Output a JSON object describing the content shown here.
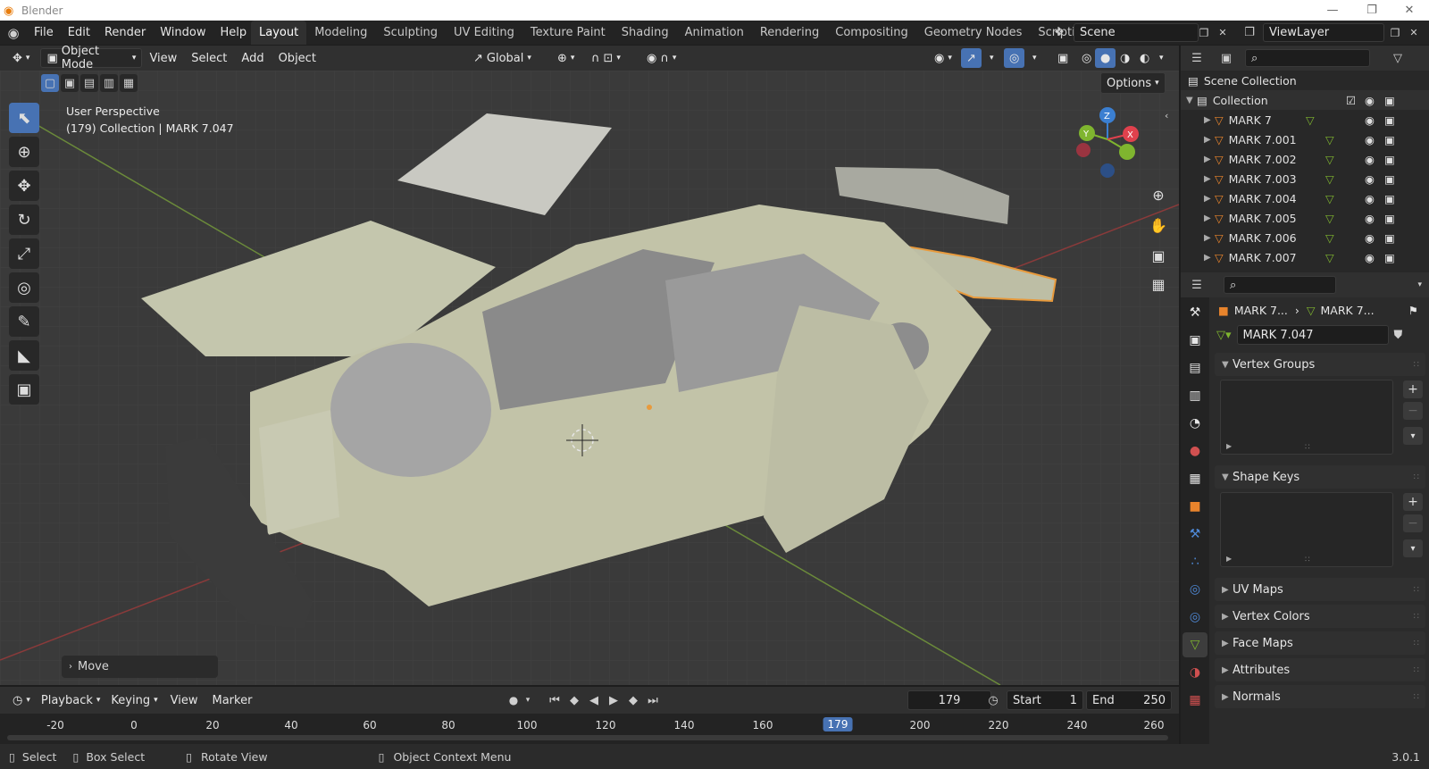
{
  "window": {
    "title": "Blender"
  },
  "menu": {
    "file": "File",
    "edit": "Edit",
    "render": "Render",
    "window": "Window",
    "help": "Help"
  },
  "workspaces": [
    "Layout",
    "Modeling",
    "Sculpting",
    "UV Editing",
    "Texture Paint",
    "Shading",
    "Animation",
    "Rendering",
    "Compositing",
    "Geometry Nodes",
    "Scripting"
  ],
  "scene": {
    "name": "Scene",
    "view_layer": "ViewLayer"
  },
  "viewport_header": {
    "mode": "Object Mode",
    "view": "View",
    "select": "Select",
    "add": "Add",
    "object": "Object",
    "orientation": "Global",
    "options": "Options"
  },
  "viewport": {
    "perspective": "User Perspective",
    "info": "(179) Collection | MARK 7.047",
    "last_op": "Move",
    "gizmo_x": "X",
    "gizmo_y": "Y",
    "gizmo_z": "Z"
  },
  "timeline": {
    "playback": "Playback",
    "keying": "Keying",
    "view": "View",
    "marker": "Marker",
    "current_frame": "179",
    "start_label": "Start",
    "start": "1",
    "end_label": "End",
    "end": "250",
    "ruler": [
      "-20",
      "0",
      "20",
      "40",
      "60",
      "80",
      "100",
      "120",
      "140",
      "160",
      "179",
      "200",
      "220",
      "240",
      "260"
    ]
  },
  "status": {
    "select": "Select",
    "box_select": "Box Select",
    "rotate": "Rotate View",
    "context": "Object Context Menu",
    "version": "3.0.1"
  },
  "outliner": {
    "scene_collection": "Scene Collection",
    "collection": "Collection",
    "items": [
      "MARK 7",
      "MARK 7.001",
      "MARK 7.002",
      "MARK 7.003",
      "MARK 7.004",
      "MARK 7.005",
      "MARK 7.006",
      "MARK 7.007"
    ]
  },
  "properties": {
    "breadcrumb_object": "MARK 7...",
    "breadcrumb_mesh": "MARK 7...",
    "mesh_name": "MARK 7.047",
    "panels": {
      "vertex_groups": "Vertex Groups",
      "shape_keys": "Shape Keys",
      "uv_maps": "UV Maps",
      "vertex_colors": "Vertex Colors",
      "face_maps": "Face Maps",
      "attributes": "Attributes",
      "normals": "Normals"
    }
  },
  "colors": {
    "accent": "#4772b3",
    "selection": "#e89a3c",
    "x_axis": "#e0414d",
    "y_axis": "#7fb52f",
    "z_axis": "#3b7fd1",
    "body": "#bfbf9f"
  }
}
